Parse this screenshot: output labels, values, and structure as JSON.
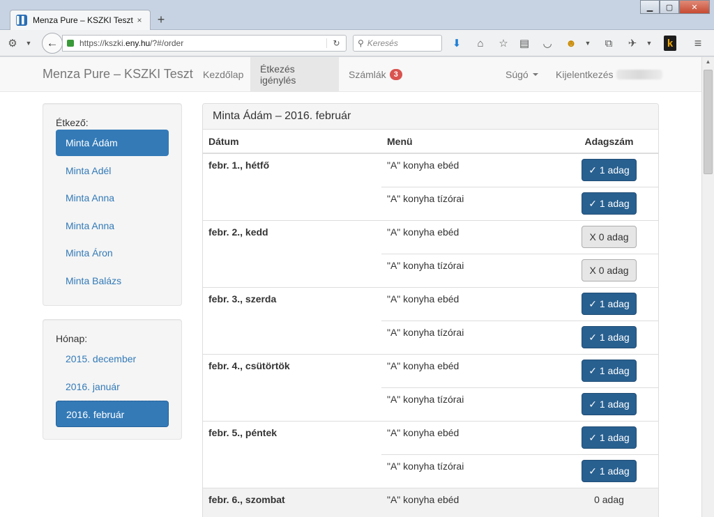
{
  "browser": {
    "tab_title": "Menza Pure – KSZKI Teszt",
    "tab_close": "×",
    "newtab": "+",
    "url_prefix": "https://kszki.",
    "url_domain": "eny.hu",
    "url_suffix": "/?#/order",
    "search_placeholder": "Keresés",
    "icons": [
      "download-icon",
      "home-icon",
      "star-icon",
      "reading-list-icon",
      "pocket-icon",
      "addon-icon",
      "sync-icon",
      "pin-icon",
      "extension-k-icon",
      "hamburger-menu-icon"
    ]
  },
  "nav": {
    "brand": "Menza Pure – KSZKI Teszt",
    "home": "Kezdőlap",
    "order": "Étkezés igénylés",
    "invoices": "Számlák",
    "invoices_badge": "3",
    "help": "Súgó",
    "logout": "Kijelentkezés"
  },
  "diners": {
    "label": "Étkező:",
    "items": [
      "Minta Ádám",
      "Minta Adél",
      "Minta Anna",
      "Minta Anna",
      "Minta Áron",
      "Minta Balázs"
    ],
    "active_index": 0
  },
  "months": {
    "label": "Hónap:",
    "items": [
      "2015. december",
      "2016. január",
      "2016. február"
    ],
    "active_index": 2
  },
  "panel": {
    "title": "Minta Ádám – 2016. február",
    "headers": {
      "date": "Dátum",
      "menu": "Menü",
      "portions": "Adagszám"
    }
  },
  "days": [
    {
      "date": "febr. 1., hétfő",
      "meals": [
        {
          "menu": "\"A\" konyha ebéd",
          "portion": "✓ 1 adag",
          "on": true
        },
        {
          "menu": "\"A\" konyha tízórai",
          "portion": "✓ 1 adag",
          "on": true
        }
      ]
    },
    {
      "date": "febr. 2., kedd",
      "meals": [
        {
          "menu": "\"A\" konyha ebéd",
          "portion": "X 0 adag",
          "on": false
        },
        {
          "menu": "\"A\" konyha tízórai",
          "portion": "X 0 adag",
          "on": false
        }
      ]
    },
    {
      "date": "febr. 3., szerda",
      "meals": [
        {
          "menu": "\"A\" konyha ebéd",
          "portion": "✓ 1 adag",
          "on": true
        },
        {
          "menu": "\"A\" konyha tízórai",
          "portion": "✓ 1 adag",
          "on": true
        }
      ]
    },
    {
      "date": "febr. 4., csütörtök",
      "meals": [
        {
          "menu": "\"A\" konyha ebéd",
          "portion": "✓ 1 adag",
          "on": true
        },
        {
          "menu": "\"A\" konyha tízórai",
          "portion": "✓ 1 adag",
          "on": true
        }
      ]
    },
    {
      "date": "febr. 5., péntek",
      "meals": [
        {
          "menu": "\"A\" konyha ebéd",
          "portion": "✓ 1 adag",
          "on": true
        },
        {
          "menu": "\"A\" konyha tízórai",
          "portion": "✓ 1 adag",
          "on": true
        }
      ]
    },
    {
      "date": "febr. 6., szombat",
      "meals": [
        {
          "menu": "\"A\" konyha ebéd",
          "portion": "0 adag",
          "plain": true
        }
      ]
    }
  ],
  "colors": {
    "primary": "#337ab7",
    "primary_dark": "#286090",
    "badge": "#d9534f"
  }
}
